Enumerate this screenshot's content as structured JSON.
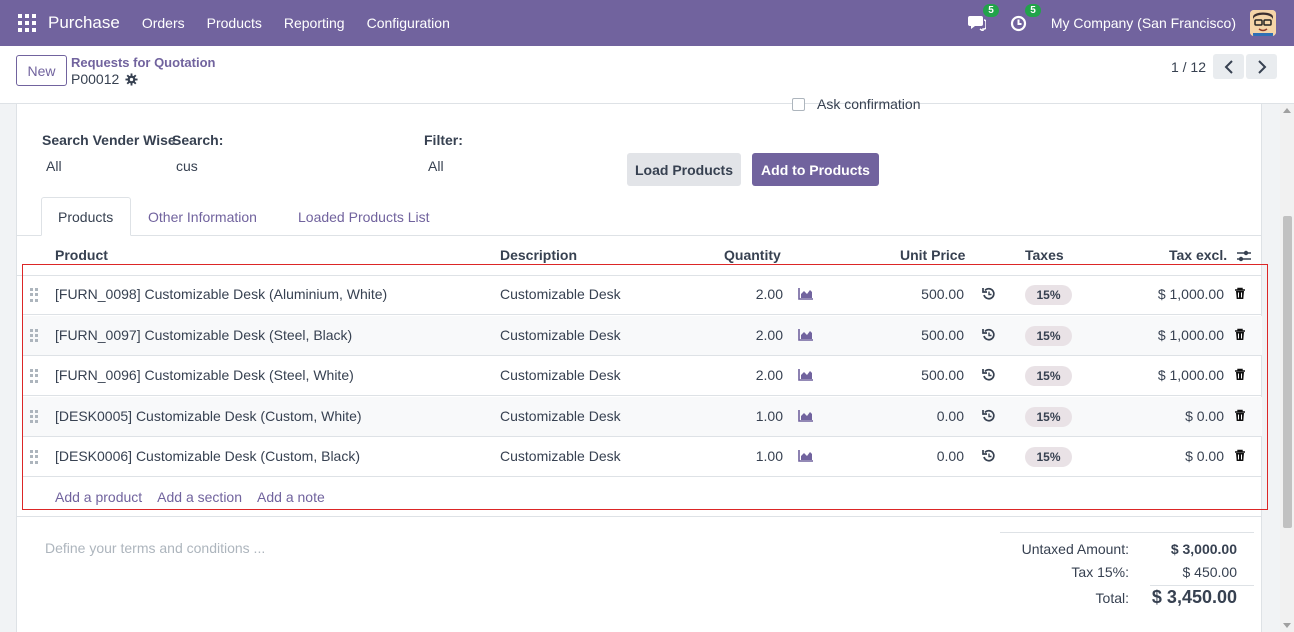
{
  "nav": {
    "app": "Purchase",
    "menu": [
      "Orders",
      "Products",
      "Reporting",
      "Configuration"
    ],
    "messages_count": "5",
    "activities_count": "5",
    "company": "My Company (San Francisco)"
  },
  "control": {
    "new_label": "New",
    "breadcrumb": "Requests for Quotation",
    "record": "P00012",
    "pager": "1 / 12"
  },
  "form": {
    "ask_confirmation": "Ask confirmation",
    "search_vendor_label": "Search Vender Wise",
    "search_vendor_value": "All",
    "search_label": "Search:",
    "search_value": "cus",
    "filter_label": "Filter:",
    "filter_value": "All",
    "load_products": "Load Products",
    "add_to_products": "Add to Products"
  },
  "tabs": [
    "Products",
    "Other Information",
    "Loaded Products List"
  ],
  "table": {
    "headers": [
      "Product",
      "Description",
      "Quantity",
      "Unit Price",
      "Taxes",
      "Tax excl."
    ],
    "rows": [
      {
        "product": "[FURN_0098] Customizable Desk (Aluminium, White)",
        "description": "Customizable Desk",
        "quantity": "2.00",
        "unit_price": "500.00",
        "tax": "15%",
        "subtotal": "$ 1,000.00"
      },
      {
        "product": "[FURN_0097] Customizable Desk (Steel, Black)",
        "description": "Customizable Desk",
        "quantity": "2.00",
        "unit_price": "500.00",
        "tax": "15%",
        "subtotal": "$ 1,000.00"
      },
      {
        "product": "[FURN_0096] Customizable Desk (Steel, White)",
        "description": "Customizable Desk",
        "quantity": "2.00",
        "unit_price": "500.00",
        "tax": "15%",
        "subtotal": "$ 1,000.00"
      },
      {
        "product": "[DESK0005] Customizable Desk (Custom, White)",
        "description": "Customizable Desk",
        "quantity": "1.00",
        "unit_price": "0.00",
        "tax": "15%",
        "subtotal": "$ 0.00"
      },
      {
        "product": "[DESK0006] Customizable Desk (Custom, Black)",
        "description": "Customizable Desk",
        "quantity": "1.00",
        "unit_price": "0.00",
        "tax": "15%",
        "subtotal": "$ 0.00"
      }
    ],
    "add_product": "Add a product",
    "add_section": "Add a section",
    "add_note": "Add a note"
  },
  "footer": {
    "terms_placeholder": "Define your terms and conditions ...",
    "untaxed_label": "Untaxed Amount:",
    "untaxed_value": "$ 3,000.00",
    "tax_label": "Tax 15%:",
    "tax_value": "$ 450.00",
    "total_label": "Total:",
    "total_value": "$ 3,450.00"
  },
  "colors": {
    "brand": "#71639e",
    "highlight": "#dc2626"
  }
}
